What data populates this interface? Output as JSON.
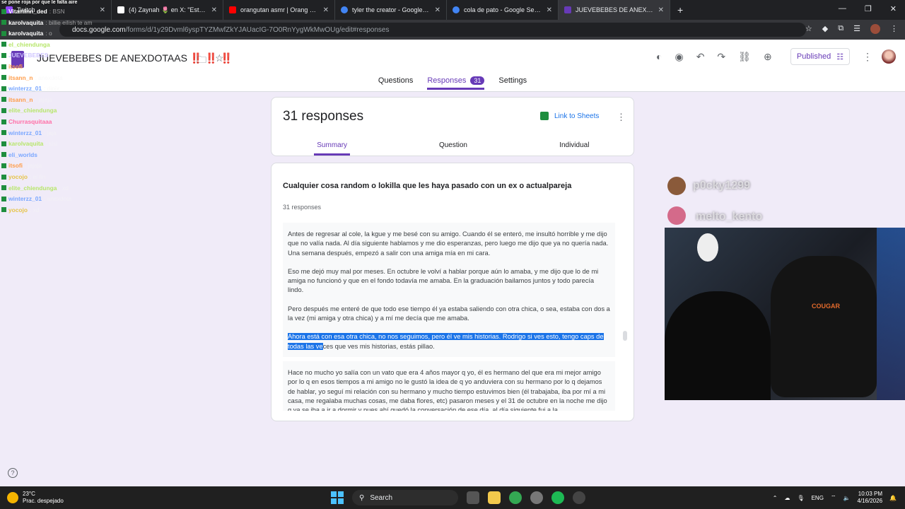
{
  "browser": {
    "tabs": [
      {
        "title": "Twitch",
        "color": "#9146ff"
      },
      {
        "title": "(4) Zaynah 🌷 en X: \"Esto confi",
        "color": "#ffffff"
      },
      {
        "title": "orangutan asmr | Orang Utan A",
        "color": "#ff0000"
      },
      {
        "title": "tyler the creator - Google Searc",
        "color": "#4285f4"
      },
      {
        "title": "cola de pato - Google Search",
        "color": "#4285f4"
      },
      {
        "title": "JUEVEBEBES DE ANEXDOTAAS!",
        "color": "#673ab7"
      }
    ],
    "url_domain": "docs.google.com",
    "url_path": "/forms/d/1y29Dvml6yspTYZMwfZkYJAUacIG-7O0RnYygWkMwOUg/edit#responses"
  },
  "form": {
    "title": "JUEVEBEBES DE ANEXDOTAAS ‼️ ‼️ ‼️",
    "published_label": "Published",
    "nav": {
      "questions": "Questions",
      "responses": "Responses",
      "responses_count": "31",
      "settings": "Settings"
    }
  },
  "summary_card": {
    "title": "31 responses",
    "link_sheets": "Link to Sheets",
    "subtabs": {
      "summary": "Summary",
      "question": "Question",
      "individual": "Individual"
    }
  },
  "question_card": {
    "title": "Cualquier cosa random o lokilla que les haya pasado con un ex o actualpareja",
    "count": "31 responses",
    "answer1": {
      "p1": "Antes de regresar al cole, la kgue y me besé con su amigo. Cuando él se enteró, me insultó horrible y me dijo que no valía nada. Al día siguiente hablamos y me dio esperanzas, pero luego me dijo que ya no quería nada. Una semana después, empezó a salir con una amiga mía en mi cara.",
      "p2": "Eso me dejó muy mal por meses. En octubre le volví a hablar porque aún lo amaba, y me dijo que lo de mi amiga no funcionó y que en el fondo todavía me amaba. En la graduación bailamos juntos y todo parecía lindo.",
      "p3": "Pero después me enteré de que todo ese tiempo él ya estaba saliendo con otra chica, o sea, estaba con dos a la vez (mi amiga y otra chica) y a mí me decía que me amaba.",
      "p4_highlight": "Ahora está con esa otra chica, no nos seguimos, pero él ve mis historias. Rodrigo si ves esto, tengo caps de todas las ve",
      "p4_rest": "ces que ves mis historias, estás pillao."
    },
    "answer2": "Hace no mucho yo salía con un vato que era 4 años mayor q yo, él es hermano del que era mi mejor amigo por lo q en esos tiempos a mi amigo no le gustó la idea de q yo anduviera con su hermano por lo q dejamos de hablar, yo seguí mi relación con su hermano y mucho tiempo estuvimos bien (él trabajaba, iba por mí a mi casa, me regalaba muchas cosas, me daba flores, etc) pasaron meses y el 31 de octubre en la noche me dijo q ya se iba a ir a dormir y pues ahí quedó la conversación de ese día, al día siguiente fui a la"
  },
  "chat": {
    "top": "se pone roja por que le falta aire",
    "lines": [
      {
        "user": "Vitaminn_ded",
        "msg": ": BSN",
        "color": "#ffffff"
      },
      {
        "user": "karolvaquita",
        "msg": ": billie eilish te am",
        "color": "#ffffff"
      },
      {
        "user": "karolvaquita",
        "msg": ": o",
        "color": "#ffffff"
      },
      {
        "user": "el_chiendunga",
        "msg": "",
        "color": "#b7e66b"
      },
      {
        "user": "JUEVEBEBES",
        "msg": "",
        "color": "#cfc6ff"
      },
      {
        "user": "itsofi",
        "msg": "",
        "color": "#ff9d4a"
      },
      {
        "user": "itsann_n",
        "msg": ": anexdota",
        "color": "#ff9d4a"
      },
      {
        "user": "winterzz_01",
        "msg": ": dinix",
        "color": "#7aa7ff"
      },
      {
        "user": "itsann_n",
        "msg": ": jajaja",
        "color": "#ff9d4a"
      },
      {
        "user": "elite_chiendunga",
        "msg": "",
        "color": "#b7e66b"
      },
      {
        "user": "Churrasquitaaa",
        "msg": "",
        "color": "#ff6fa6"
      },
      {
        "user": "winterzz_01",
        "msg": ": jaja",
        "color": "#7aa7ff"
      },
      {
        "user": "karolvaquita",
        "msg": ": sisi",
        "color": "#b7e66b"
      },
      {
        "user": "eli_worlds",
        "msg": "",
        "color": "#7aa7ff"
      },
      {
        "user": "itsofi",
        "msg": ": jajaja",
        "color": "#ff9d4a"
      },
      {
        "user": "yocojo",
        "msg": ": el fin",
        "color": "#e6c44a"
      },
      {
        "user": "elite_chiendunga",
        "msg": ": xd",
        "color": "#b7e66b"
      },
      {
        "user": "winterzz_01",
        "msg": ": anexdota",
        "color": "#7aa7ff"
      },
      {
        "user": "yocojo",
        "msg": ": xd",
        "color": "#e6c44a"
      }
    ]
  },
  "overlay": {
    "viewer1": "p0cky1299",
    "viewer2": "melto_kento",
    "chair_brand": "COUGAR"
  },
  "taskbar": {
    "temp": "23°C",
    "weather": "Prac. despejado",
    "search": "Search",
    "lang": "ENG",
    "time": "10:03 PM",
    "date": "4/16/2026"
  },
  "colors": {
    "accent": "#673ab7",
    "background": "#f0ebf8",
    "selection": "#1a73e8"
  }
}
